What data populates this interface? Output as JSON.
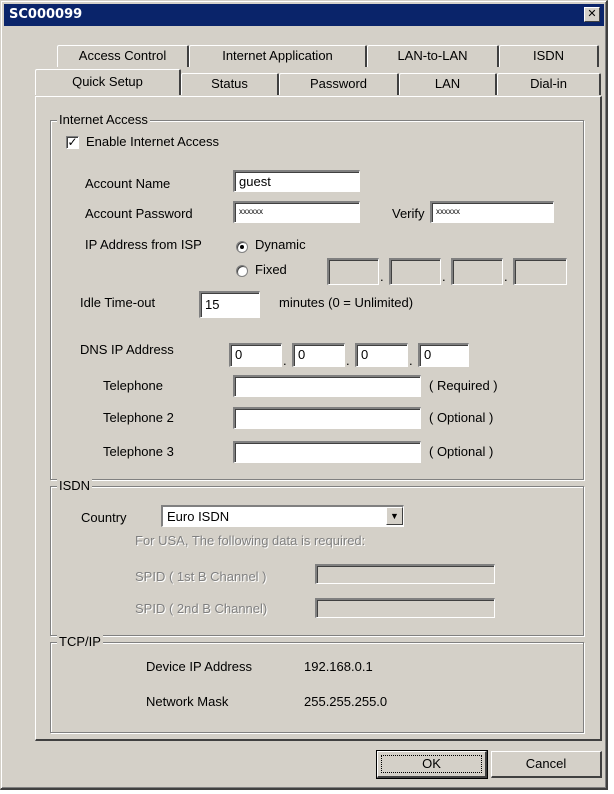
{
  "window": {
    "title": "SC000099",
    "close_glyph": "✕"
  },
  "tabs": {
    "row_back": [
      "Access Control",
      "Internet Application",
      "LAN-to-LAN",
      "ISDN"
    ],
    "row_front": [
      "Quick Setup",
      "Status",
      "Password",
      "LAN",
      "Dial-in"
    ],
    "active": "Quick Setup"
  },
  "internet_access": {
    "legend": "Internet Access",
    "enable_label": "Enable Internet Access",
    "enable_checked": true,
    "enable_mark": "✓",
    "account_name_label": "Account Name",
    "account_name_value": "guest",
    "account_password_label": "Account Password",
    "account_password_value": "xxxxxx",
    "verify_label": "Verify",
    "verify_value": "xxxxxx",
    "ip_from_isp_label": "IP Address from ISP",
    "dynamic_label": "Dynamic",
    "fixed_label": "Fixed",
    "ip_mode": "Dynamic",
    "fixed_ip": [
      "",
      "",
      "",
      ""
    ],
    "idle_timeout_label": "Idle Time-out",
    "idle_timeout_value": "15",
    "idle_timeout_suffix": "minutes  (0 = Unlimited)",
    "dns_label": "DNS IP Address",
    "dns_ip": [
      "0",
      "0",
      "0",
      "0"
    ],
    "ip_separator": ".",
    "telephone_label": "Telephone",
    "telephone_value": "",
    "telephone_note": "( Required )",
    "telephone2_label": "Telephone 2",
    "telephone2_value": "",
    "telephone2_note": "( Optional )",
    "telephone3_label": "Telephone 3",
    "telephone3_value": "",
    "telephone3_note": "( Optional )"
  },
  "isdn": {
    "legend": "ISDN",
    "country_label": "Country",
    "country_value": "Euro ISDN",
    "usa_note": "For USA, The following data is required:",
    "spid1_label": "SPID ( 1st B Channel )",
    "spid1_value": "",
    "spid2_label": "SPID ( 2nd B Channel)",
    "spid2_value": ""
  },
  "tcpip": {
    "legend": "TCP/IP",
    "device_ip_label": "Device IP Address",
    "device_ip_value": "192.168.0.1",
    "netmask_label": "Network Mask",
    "netmask_value": "255.255.255.0"
  },
  "buttons": {
    "ok": "OK",
    "cancel": "Cancel"
  }
}
